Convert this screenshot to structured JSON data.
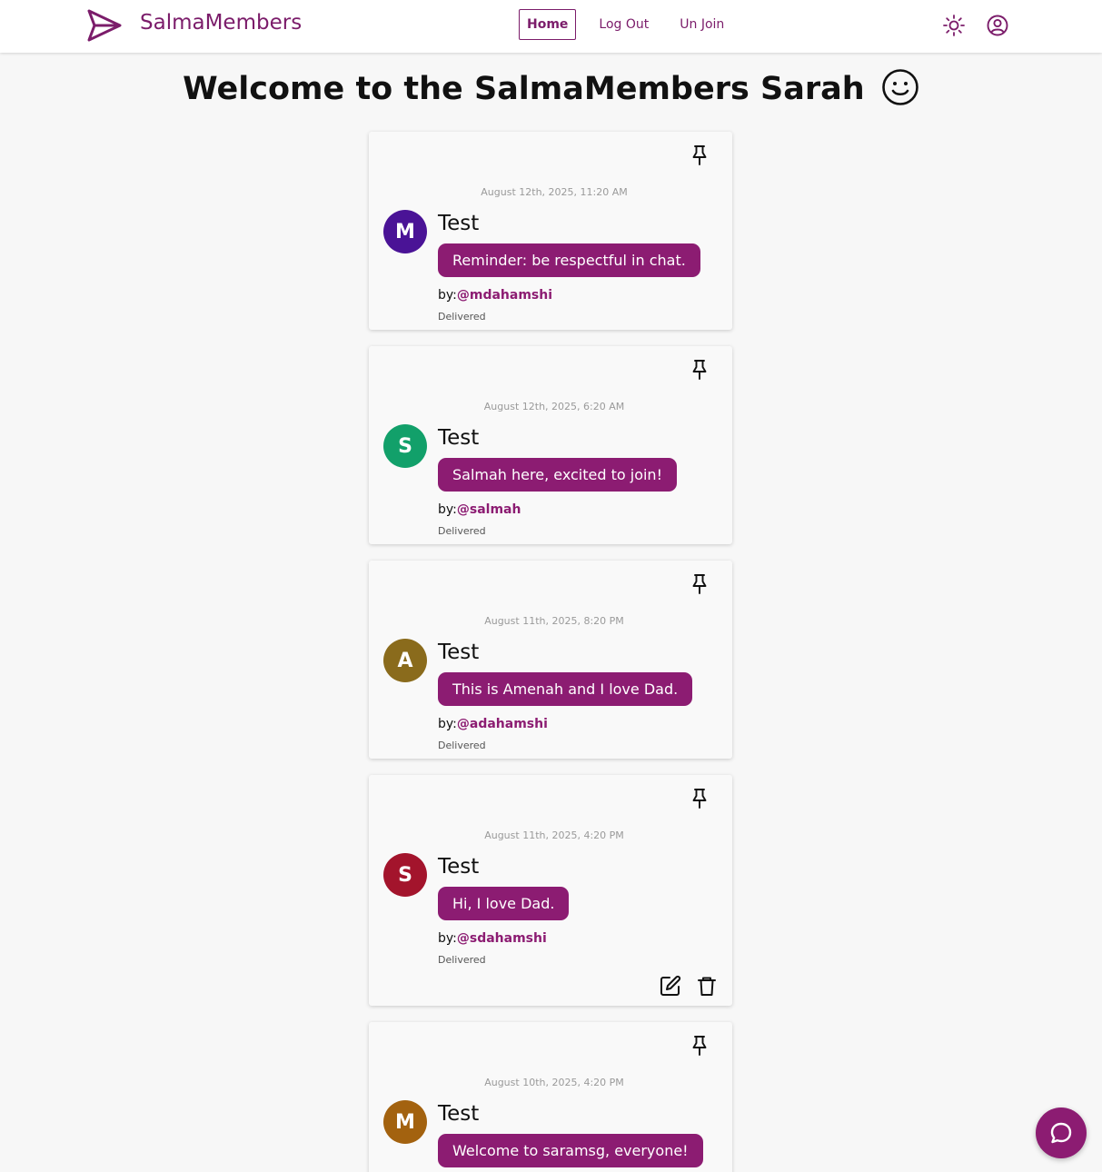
{
  "brand": {
    "name": "SalmaMembers",
    "accent": "#7b1c6a"
  },
  "nav": {
    "links": [
      {
        "label": "Home",
        "active": true
      },
      {
        "label": "Log Out",
        "active": false
      },
      {
        "label": "Un Join",
        "active": false
      }
    ],
    "icons": [
      "sun-icon",
      "user-circle-icon"
    ]
  },
  "page": {
    "title": "Welcome to the SalmaMembers Sarah"
  },
  "messages": [
    {
      "timestamp": "August 12th, 2025, 11:20 AM",
      "initial": "M",
      "avatar_color": "#4a1396",
      "title": "Test",
      "body": "Reminder: be respectful in chat.",
      "by_prefix": "by:",
      "handle": "@mdahamshi",
      "status": "Delivered",
      "owner_actions": false
    },
    {
      "timestamp": "August 12th, 2025, 6:20 AM",
      "initial": "S",
      "avatar_color": "#12a06a",
      "title": "Test",
      "body": "Salmah here, excited to join!",
      "by_prefix": "by:",
      "handle": "@salmah",
      "status": "Delivered",
      "owner_actions": false
    },
    {
      "timestamp": "August 11th, 2025, 8:20 PM",
      "initial": "A",
      "avatar_color": "#8a6b1c",
      "title": "Test",
      "body": "This is Amenah and I love Dad.",
      "by_prefix": "by:",
      "handle": "@adahamshi",
      "status": "Delivered",
      "owner_actions": false
    },
    {
      "timestamp": "August 11th, 2025, 4:20 PM",
      "initial": "S",
      "avatar_color": "#a3142c",
      "title": "Test",
      "body": "Hi, I love Dad.",
      "by_prefix": "by:",
      "handle": "@sdahamshi",
      "status": "Delivered",
      "owner_actions": true
    },
    {
      "timestamp": "August 10th, 2025, 4:20 PM",
      "initial": "M",
      "avatar_color": "#a3620f",
      "title": "Test",
      "body": "Welcome to saramsg, everyone!",
      "by_prefix": "",
      "handle": "",
      "status": "",
      "owner_actions": false
    }
  ],
  "fab": {
    "icon": "chat-bubble-icon",
    "color": "#8c1c72"
  }
}
